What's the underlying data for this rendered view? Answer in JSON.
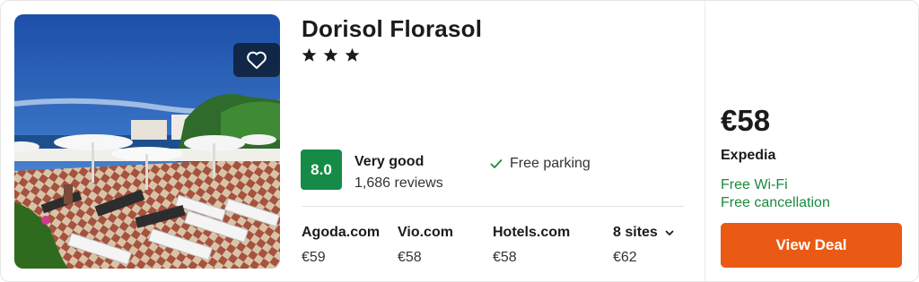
{
  "hotel": {
    "name": "Dorisol Florasol",
    "star_count": 3
  },
  "rating": {
    "score": "8.0",
    "label": "Very good",
    "reviews": "1,686 reviews",
    "score_color": "#158b47"
  },
  "amenities": {
    "parking": "Free parking",
    "check_icon": "check-icon"
  },
  "other_sites": [
    {
      "name": "Agoda.com",
      "price": "€59"
    },
    {
      "name": "Vio.com",
      "price": "€58"
    },
    {
      "name": "Hotels.com",
      "price": "€58"
    },
    {
      "name": "8 sites",
      "price": "€62"
    }
  ],
  "deal": {
    "price": "€58",
    "provider": "Expedia",
    "perks": [
      "Free Wi-Fi",
      "Free cancellation"
    ],
    "button_label": "View Deal",
    "button_color": "#ea5a14"
  },
  "icons": {
    "favorite": "heart-icon",
    "star": "star-icon",
    "expand": "chevron-down-icon"
  }
}
